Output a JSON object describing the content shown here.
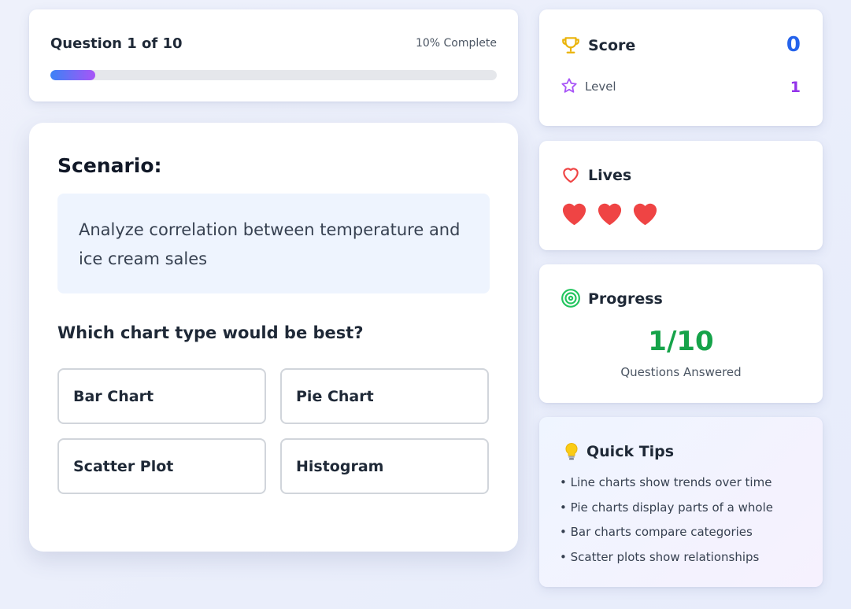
{
  "header": {
    "question_counter": "Question 1 of 10",
    "complete_text": "10% Complete",
    "progress_fraction": 0.1
  },
  "question": {
    "scenario_heading": "Scenario:",
    "scenario_text": "Analyze correlation between temperature and ice cream sales",
    "prompt": "Which chart type would be best?",
    "options": [
      "Bar Chart",
      "Pie Chart",
      "Scatter Plot",
      "Histogram"
    ]
  },
  "score": {
    "title": "Score",
    "value": "0",
    "level_label": "Level",
    "level_value": "1"
  },
  "lives": {
    "title": "Lives",
    "count": 3
  },
  "progress": {
    "title": "Progress",
    "value": "1/10",
    "label": "Questions Answered"
  },
  "tips": {
    "title": "Quick Tips",
    "items": [
      "• Line charts show trends over time",
      "• Pie charts display parts of a whole",
      "• Bar charts compare categories",
      "• Scatter plots show relationships"
    ]
  },
  "icons": {
    "score": "trophy-icon",
    "level": "star-icon",
    "lives": "heart-outline-icon",
    "life": "heart-icon",
    "progress": "target-icon",
    "tips": "lightbulb-icon"
  },
  "colors": {
    "progress_start": "#3b82f6",
    "progress_end": "#a855f7",
    "score": "#2563eb",
    "level": "#9333ea",
    "heart": "#ef4444",
    "progress_stat": "#16a34a",
    "trophy": "#eab308"
  }
}
